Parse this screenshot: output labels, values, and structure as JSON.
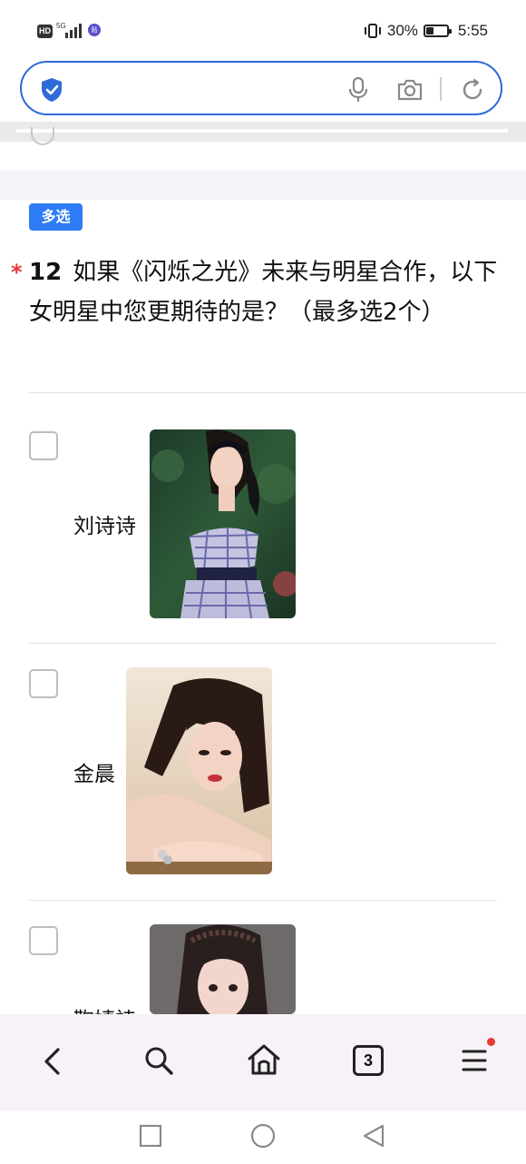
{
  "status_bar": {
    "hd": "HD",
    "network": "5G",
    "app_badge": "贴",
    "battery_percent": "30%",
    "time": "5:55"
  },
  "search": {
    "value": "",
    "placeholder": ""
  },
  "question": {
    "type_tag": "多选",
    "required_mark": "*",
    "number": "12",
    "text": "如果《闪烁之光》未来与明星合作，以下女明星中您更期待的是？（最多选2个）"
  },
  "options": [
    {
      "label": "刘诗诗",
      "checked": false
    },
    {
      "label": "金晨",
      "checked": false
    },
    {
      "label": "鞠婧祎",
      "checked": false
    }
  ],
  "bottom_nav": {
    "tab_count": "3",
    "menu_has_notification": true
  },
  "colors": {
    "accent": "#2f6ad9",
    "tag_bg": "#2e7cf6",
    "required": "#e53935"
  }
}
